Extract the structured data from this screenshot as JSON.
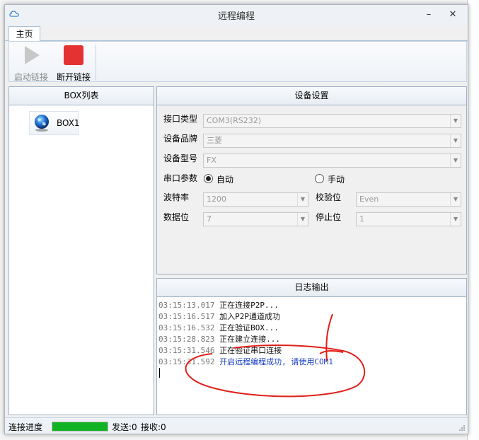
{
  "window": {
    "title": "远程编程",
    "minimize": "–",
    "close": "✕"
  },
  "ribbon": {
    "tab": "主页",
    "start_label": "启动链接",
    "stop_label": "断开链接"
  },
  "box_panel": {
    "title": "BOX列表",
    "items": [
      "BOX1"
    ]
  },
  "device_settings": {
    "title": "设备设置",
    "interface_label": "接口类型",
    "interface_value": "COM3(RS232)",
    "brand_label": "设备品牌",
    "brand_value": "三菱",
    "model_label": "设备型号",
    "model_value": "FX",
    "serial_label": "串口参数",
    "auto_label": "自动",
    "manual_label": "手动",
    "baud_label": "波特率",
    "baud_value": "1200",
    "parity_label": "校验位",
    "parity_value": "Even",
    "databits_label": "数据位",
    "databits_value": "7",
    "stopbits_label": "停止位",
    "stopbits_value": "1",
    "selected_mode": "auto"
  },
  "log": {
    "title": "日志输出",
    "lines": [
      {
        "time": "03:15:13.017",
        "text": "正在连接P2P..."
      },
      {
        "time": "03:15:16.517",
        "text": "加入P2P通道成功"
      },
      {
        "time": "03:15:16.532",
        "text": "正在验证BOX..."
      },
      {
        "time": "03:15:28.823",
        "text": "正在建立连接..."
      },
      {
        "time": "03:15:31.546",
        "text": "正在验证串口连接"
      },
      {
        "time": "03:15:31.592",
        "text": "开启远程编程成功, 请使用COM1"
      }
    ]
  },
  "status": {
    "progress_label": "连接进度",
    "progress": 1.0,
    "sent": "发送:0",
    "received": "接收:0"
  },
  "colors": {
    "progress": "#12b225",
    "success_text": "#1a3fc6",
    "annotation": "#e0201a"
  }
}
